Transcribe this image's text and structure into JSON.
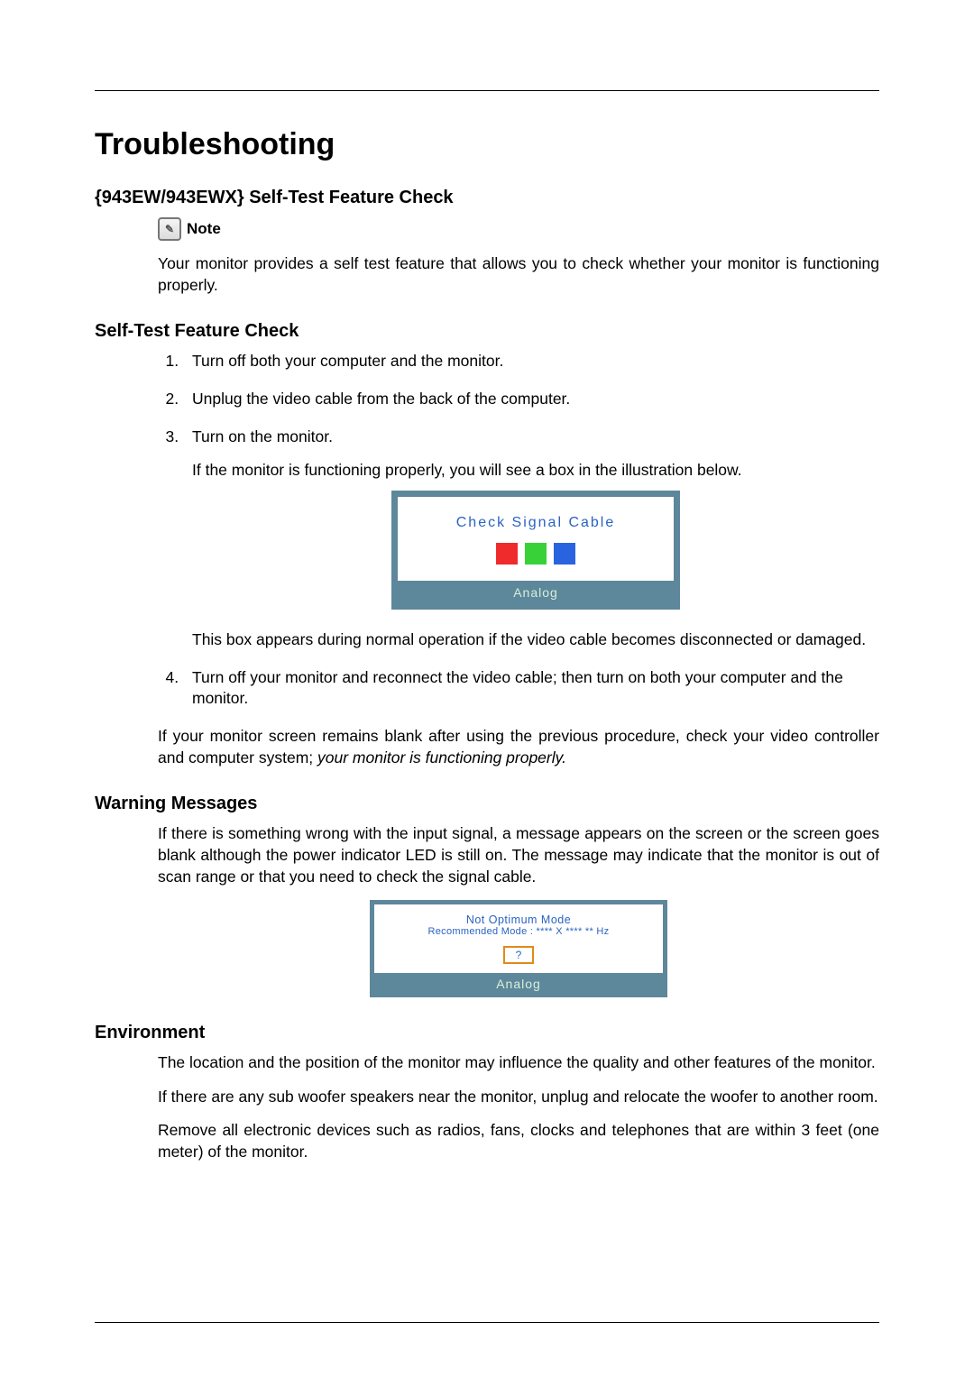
{
  "title": "Troubleshooting",
  "section1": {
    "heading": "{943EW/943EWX} Self-Test Feature Check",
    "note_label": "Note",
    "note_body": "Your monitor provides a self test feature that allows you to check whether your monitor is functioning properly."
  },
  "section2": {
    "heading": "Self-Test Feature Check",
    "steps": {
      "s1": "Turn off both your computer and the monitor.",
      "s2": "Unplug the video cable from the back of the computer.",
      "s3": "Turn on the monitor.",
      "s3_sub1": "If the monitor is functioning properly, you will see a box in the illustration below.",
      "s3_sub2": "This box appears during normal operation if the video cable becomes disconnected or damaged.",
      "s4": "Turn off your monitor and reconnect the video cable; then turn on both your computer and the monitor."
    },
    "after_steps_1": "If your monitor screen remains blank after using the previous procedure, check your video controller and computer system; ",
    "after_steps_1_em": "your monitor is functioning properly."
  },
  "osd1": {
    "title": "Check Signal Cable",
    "footer": "Analog"
  },
  "section3": {
    "heading": "Warning Messages",
    "body": "If there is something wrong with the input signal, a message appears on the screen or the screen goes blank although the power indicator LED is still on. The message may indicate that the monitor is out of scan range or that you need to check the signal cable."
  },
  "osd2": {
    "line1": "Not Optimum Mode",
    "line2": "Recommended Mode : **** X **** ** Hz",
    "q": "?",
    "footer": "Analog"
  },
  "section4": {
    "heading": "Environment",
    "p1": "The location and the position of the monitor may influence the quality and other features of the monitor.",
    "p2": "If there are any sub woofer speakers near the monitor, unplug and relocate the woofer to another room.",
    "p3": "Remove all electronic devices such as radios, fans, clocks and telephones that are within 3 feet (one meter) of the monitor."
  }
}
